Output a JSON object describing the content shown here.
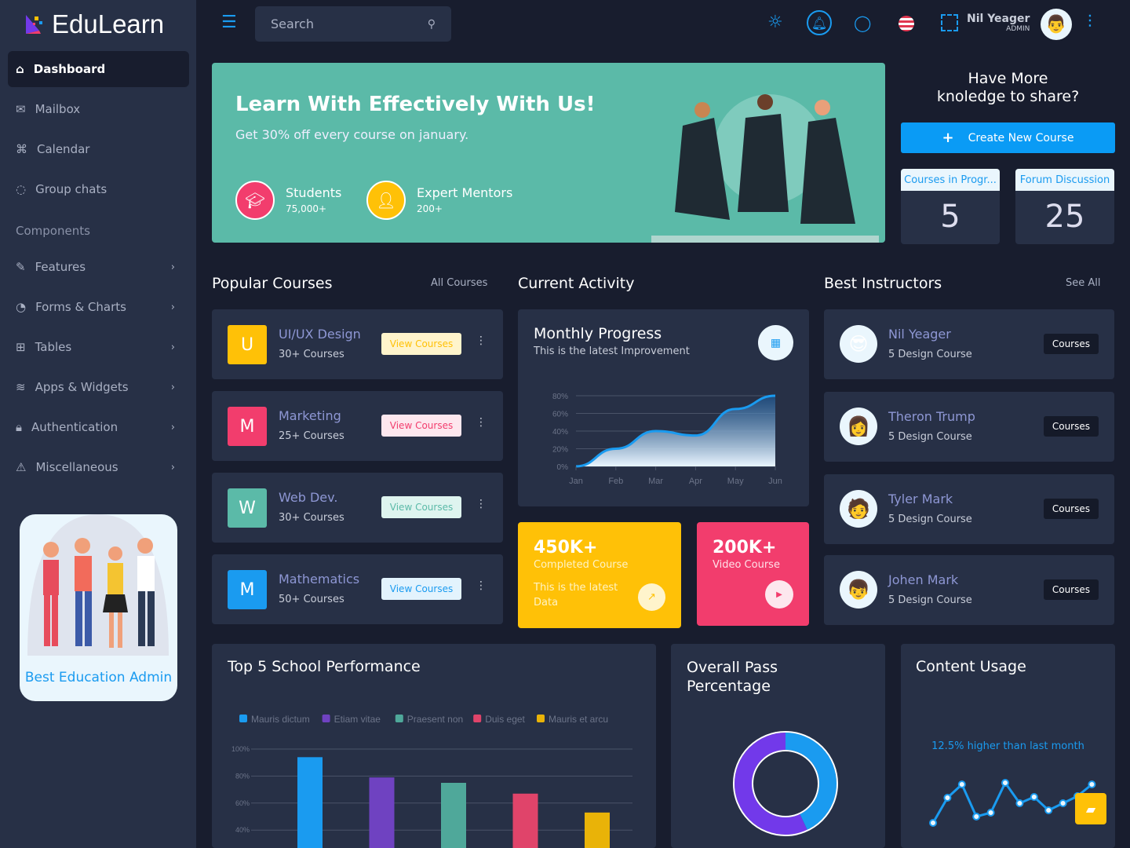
{
  "app": {
    "name": "EduLearn"
  },
  "sidebar": {
    "items": [
      {
        "label": "Dashboard",
        "icon": "home-icon"
      },
      {
        "label": "Mailbox",
        "icon": "mail-icon"
      },
      {
        "label": "Calendar",
        "icon": "command-icon"
      },
      {
        "label": "Group chats",
        "icon": "chat-icon"
      }
    ],
    "section": "Components",
    "components": [
      {
        "label": "Features",
        "icon": "edit-icon"
      },
      {
        "label": "Forms & Charts",
        "icon": "pie-icon"
      },
      {
        "label": "Tables",
        "icon": "grid-icon"
      },
      {
        "label": "Apps & Widgets",
        "icon": "database-icon"
      },
      {
        "label": "Authentication",
        "icon": "lock-icon"
      },
      {
        "label": "Miscellaneous",
        "icon": "warning-icon"
      }
    ],
    "promo": "Best Education Admin"
  },
  "topbar": {
    "search_placeholder": "Search",
    "user_name": "Nil Yeager",
    "user_role": "ADMIN"
  },
  "banner": {
    "title": "Learn With Effectively With Us!",
    "subtitle": "Get 30% off every course on january.",
    "stats": [
      {
        "label": "Students",
        "value": "75,000+",
        "color": "#f23d6d"
      },
      {
        "label": "Expert Mentors",
        "value": "200+",
        "color": "#ffc107"
      }
    ]
  },
  "share": {
    "title_line1": "Have More",
    "title_line2": "knoledge to share?",
    "button": "Create New Course",
    "kpis": [
      {
        "label": "Courses in Progr...",
        "value": "5"
      },
      {
        "label": "Forum Discussion",
        "value": "25"
      }
    ]
  },
  "popular": {
    "title": "Popular Courses",
    "link": "All Courses",
    "button": "View Courses",
    "courses": [
      {
        "letter": "U",
        "name": "UI/UX Design",
        "count": "30+ Courses",
        "color": "#ffc107",
        "btn_bg": "#fff4cc"
      },
      {
        "letter": "M",
        "name": "Marketing",
        "count": "25+ Courses",
        "color": "#f23d6d",
        "btn_bg": "#fde7ee"
      },
      {
        "letter": "W",
        "name": "Web Dev.",
        "count": "30+ Courses",
        "color": "#5bbaa8",
        "btn_bg": "#def4ef"
      },
      {
        "letter": "M",
        "name": "Mathematics",
        "count": "50+ Courses",
        "color": "#1a9bf0",
        "btn_bg": "#e3f3fd"
      }
    ]
  },
  "activity": {
    "title": "Current Activity",
    "progress_title": "Monthly Progress",
    "progress_sub": "This is the latest Improvement",
    "tiles": [
      {
        "value": "450K+",
        "label": "Completed Course",
        "note": "This is the latest Data",
        "color": "#ffc107"
      },
      {
        "value": "200K+",
        "label": "Video Course",
        "color": "#f23d6d"
      }
    ]
  },
  "instructors": {
    "title": "Best Instructors",
    "link": "See All",
    "button": "Courses",
    "items": [
      {
        "name": "Nil Yeager",
        "sub": "5 Design Course"
      },
      {
        "name": "Theron Trump",
        "sub": "5 Design Course"
      },
      {
        "name": "Tyler Mark",
        "sub": "5 Design Course"
      },
      {
        "name": "Johen Mark",
        "sub": "5 Design Course"
      }
    ]
  },
  "school": {
    "title": "Top 5 School Performance"
  },
  "pass": {
    "title_line1": "Overall Pass",
    "title_line2": "Percentage"
  },
  "usage": {
    "title": "Content Usage",
    "note": "12.5% higher than last month"
  },
  "chart_data": [
    {
      "type": "area",
      "categories": [
        "Jan",
        "Feb",
        "Mar",
        "Apr",
        "May",
        "Jun"
      ],
      "values": [
        0,
        20,
        40,
        35,
        65,
        80
      ],
      "yticks": [
        "0%",
        "20%",
        "40%",
        "60%",
        "80%"
      ],
      "ylim": [
        0,
        80
      ],
      "grid": true,
      "color": "#1a9bf0"
    },
    {
      "type": "bar",
      "categories": [
        "Mauris dictum",
        "Etiam vitae",
        "Praesent non",
        "Duis eget",
        "Mauris et arcu"
      ],
      "values": [
        94,
        79,
        75,
        67,
        53
      ],
      "colors": [
        "#1a9bf0",
        "#6f42c1",
        "#4fa89a",
        "#e0446a",
        "#e9b308"
      ],
      "yticks": [
        "40%",
        "60%",
        "80%",
        "100%"
      ],
      "ylim": [
        0,
        100
      ],
      "legend": "top-left",
      "grid": true
    },
    {
      "type": "pie",
      "style": "donut",
      "values": [
        43,
        57
      ],
      "colors": [
        "#1a9bf0",
        "#7239ea"
      ]
    },
    {
      "type": "line",
      "values": [
        6,
        38,
        55,
        14,
        19,
        57,
        31,
        39,
        22,
        31,
        40,
        55
      ],
      "color": "#1a9bf0"
    }
  ]
}
